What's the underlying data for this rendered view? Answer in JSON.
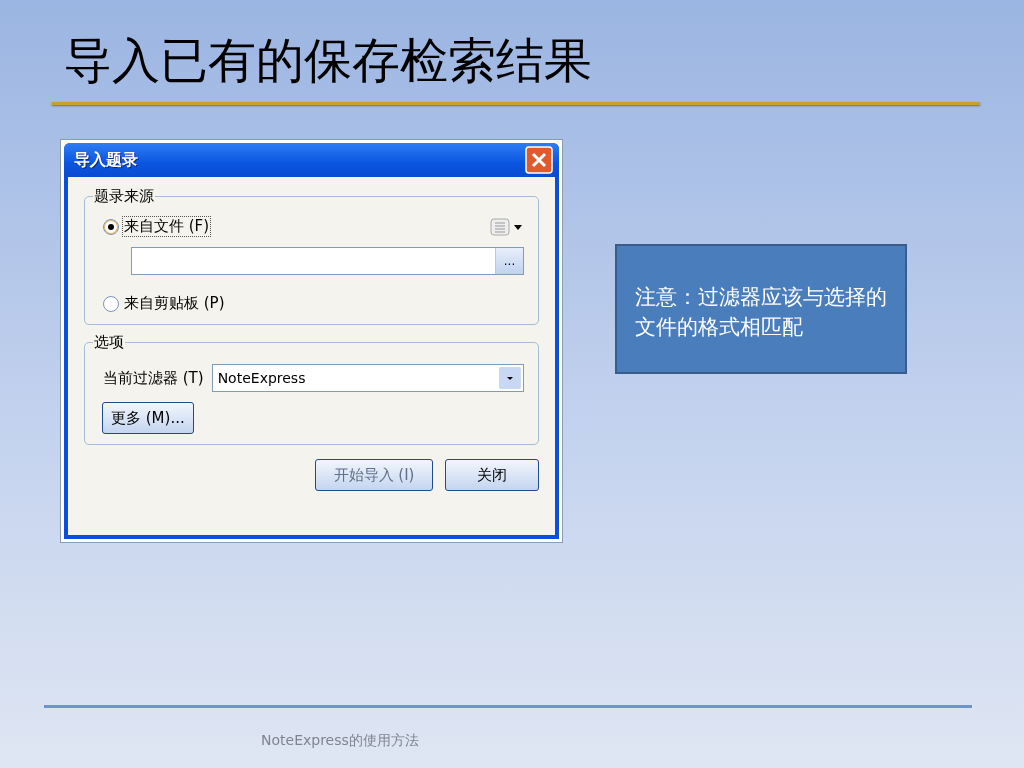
{
  "slide": {
    "title": "导入已有的保存检索结果",
    "note": "注意：过滤器应该与选择的文件的格式相匹配",
    "footer": "NoteExpress的使用方法"
  },
  "dialog": {
    "title": "导入题录",
    "source_group": {
      "label": "题录来源",
      "options": [
        {
          "label": "来自文件 (F)",
          "selected": true
        },
        {
          "label": "来自剪贴板 (P)",
          "selected": false
        }
      ],
      "browse_button": "..."
    },
    "options_group": {
      "label": "选项",
      "filter_label": "当前过滤器 (T)",
      "filter_value": "NoteExpress",
      "more_button": "更多 (M)..."
    },
    "buttons": [
      {
        "label": "开始导入 (I)",
        "disabled": true
      },
      {
        "label": "关闭",
        "disabled": false
      }
    ]
  }
}
